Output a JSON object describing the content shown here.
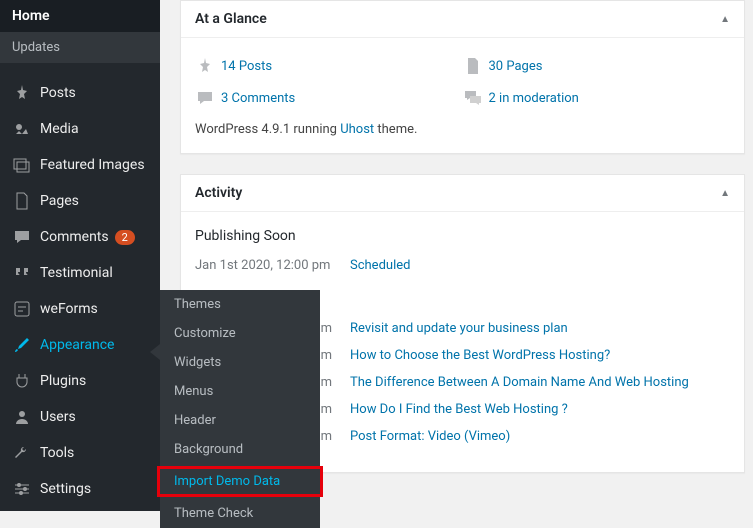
{
  "sidebar": {
    "home": "Home",
    "updates": "Updates",
    "posts": "Posts",
    "media": "Media",
    "featured_images": "Featured Images",
    "pages": "Pages",
    "comments": "Comments",
    "comments_badge": "2",
    "testimonial": "Testimonial",
    "weforms": "weForms",
    "appearance": "Appearance",
    "plugins": "Plugins",
    "users": "Users",
    "tools": "Tools",
    "settings": "Settings"
  },
  "flyout": {
    "themes": "Themes",
    "customize": "Customize",
    "widgets": "Widgets",
    "menus": "Menus",
    "header": "Header",
    "background": "Background",
    "import_demo": "Import Demo Data",
    "theme_check": "Theme Check"
  },
  "glance": {
    "title": "At a Glance",
    "posts": "14 Posts",
    "pages": "30 Pages",
    "comments": "3 Comments",
    "moderation": "2 in moderation",
    "running_prefix": "WordPress 4.9.1 running ",
    "theme_link": "Uhost",
    "running_suffix": " theme."
  },
  "activity": {
    "title": "Activity",
    "publishing_soon": "Publishing Soon",
    "rows": [
      {
        "date": "Jan 1st 2020, 12:00 pm",
        "title": "Scheduled"
      }
    ],
    "recent_rows": [
      {
        "date": "m",
        "title": "Revisit and update your business plan"
      },
      {
        "date": "m",
        "title": "How to Choose the Best WordPress Hosting?"
      },
      {
        "date": "pm",
        "title": "The Difference Between A Domain Name And Web Hosting"
      },
      {
        "date": "m",
        "title": "How Do I Find the Best Web Hosting ?"
      },
      {
        "date": "m",
        "title": "Post Format: Video (Vimeo)"
      }
    ]
  }
}
